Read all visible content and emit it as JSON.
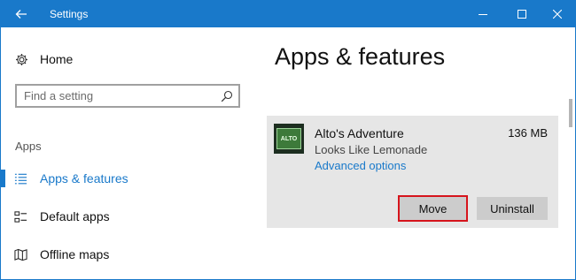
{
  "window": {
    "title": "Settings",
    "accent": "#1979ca"
  },
  "sidebar": {
    "home_label": "Home",
    "search": {
      "placeholder": "Find a setting"
    },
    "section_label": "Apps",
    "items": [
      {
        "label": "Apps & features",
        "icon": "list-icon",
        "active": true
      },
      {
        "label": "Default apps",
        "icon": "default-apps-icon",
        "active": false
      },
      {
        "label": "Offline maps",
        "icon": "map-icon",
        "active": false
      }
    ]
  },
  "main": {
    "title": "Apps & features",
    "app": {
      "name": "Alto's Adventure",
      "publisher": "Looks Like Lemonade",
      "size": "136 MB",
      "link": "Advanced options",
      "thumb_text": "ALTO",
      "buttons": {
        "move": "Move",
        "uninstall": "Uninstall"
      }
    }
  }
}
